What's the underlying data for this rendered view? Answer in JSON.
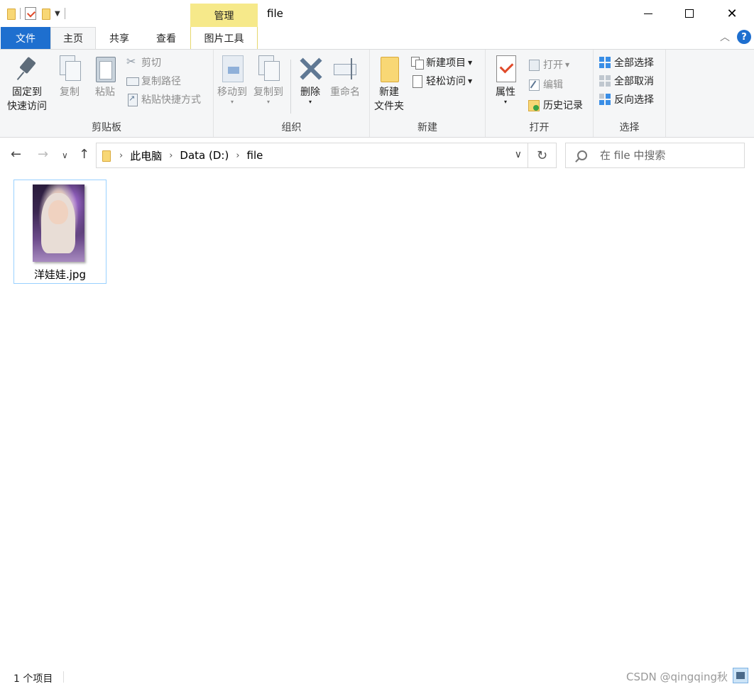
{
  "window": {
    "title": "file",
    "context_tab": "管理"
  },
  "tabs": {
    "file": "文件",
    "home": "主页",
    "share": "共享",
    "view": "查看",
    "picture_tools": "图片工具"
  },
  "ribbon": {
    "clipboard": {
      "label": "剪贴板",
      "pin": "固定到",
      "pin2": "快速访问",
      "copy": "复制",
      "paste": "粘贴",
      "cut": "剪切",
      "copy_path": "复制路径",
      "paste_shortcut": "粘贴快捷方式"
    },
    "organize": {
      "label": "组织",
      "move_to": "移动到",
      "copy_to": "复制到",
      "delete": "删除",
      "rename": "重命名"
    },
    "new": {
      "label": "新建",
      "new_folder": "新建",
      "new_folder2": "文件夹",
      "new_item": "新建项目",
      "easy_access": "轻松访问"
    },
    "open": {
      "label": "打开",
      "properties": "属性",
      "open": "打开",
      "edit": "编辑",
      "history": "历史记录"
    },
    "select": {
      "label": "选择",
      "select_all": "全部选择",
      "select_none": "全部取消",
      "invert": "反向选择"
    }
  },
  "address": {
    "crumbs": [
      "此电脑",
      "Data (D:)",
      "file"
    ]
  },
  "search": {
    "placeholder": "在 file 中搜索"
  },
  "files": [
    {
      "name": "洋娃娃.jpg"
    }
  ],
  "status": {
    "count": "1 个项目"
  },
  "watermark": "CSDN @qingqing秋",
  "colors": {
    "file_tab": "#1e6fcf",
    "context_tab": "#f6e98a",
    "ribbon_bg": "#f5f6f7",
    "selection_border": "#99d1ff"
  }
}
